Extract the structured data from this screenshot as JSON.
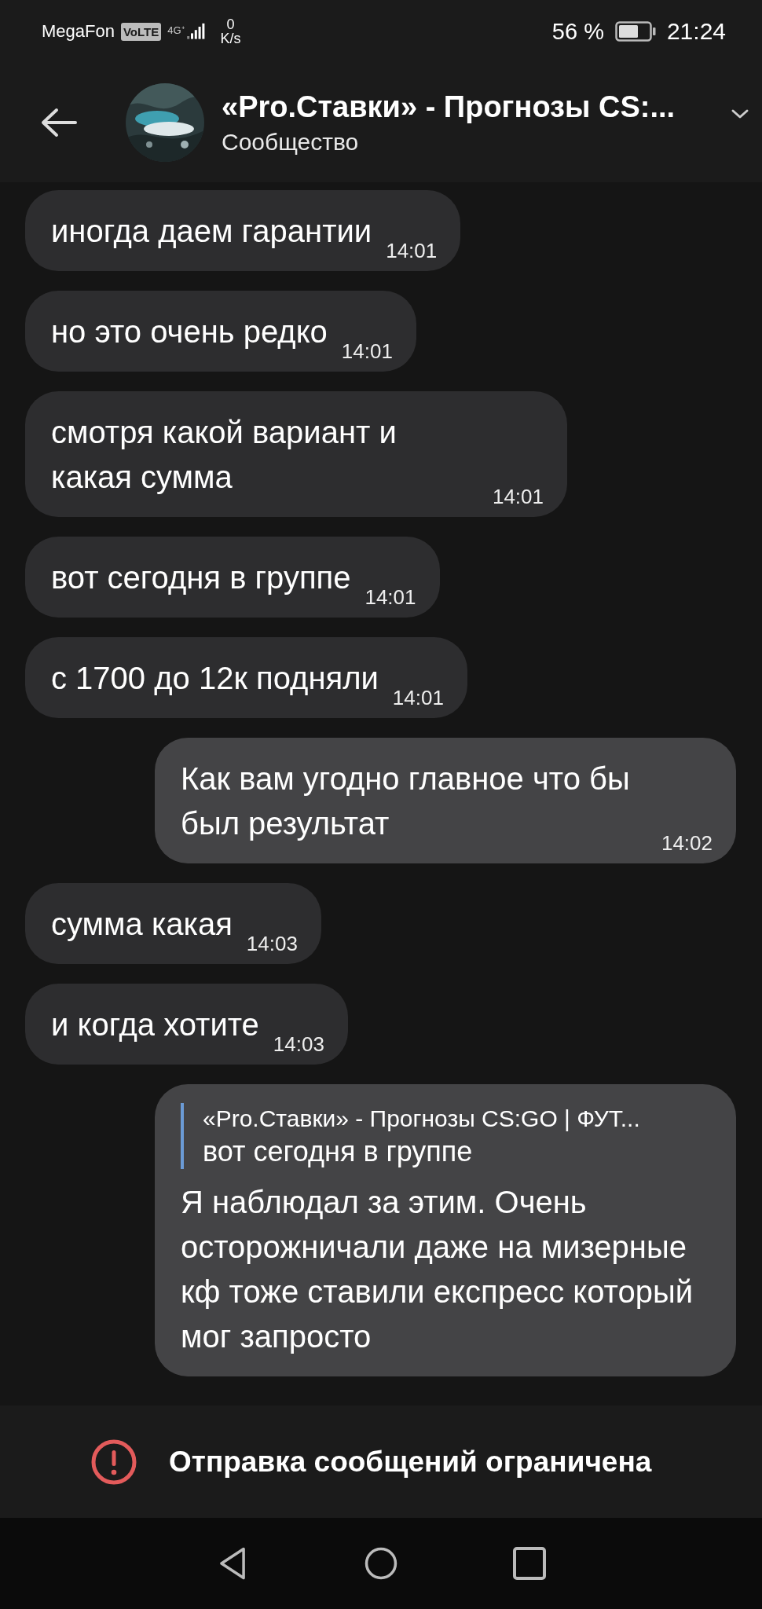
{
  "status_bar": {
    "carrier": "MegaFon",
    "volte": "VoLTE",
    "network": "4G⁺",
    "speed_value": "0",
    "speed_unit": "K/s",
    "battery": "56 %",
    "time": "21:24"
  },
  "header": {
    "title": "«Pro.Ставки» - Прогнозы CS:...",
    "subtitle": "Сообщество"
  },
  "messages": [
    {
      "kind": "incoming",
      "text": "иногда даем гарантии",
      "time": "14:01"
    },
    {
      "kind": "incoming",
      "text": "но это очень редко",
      "time": "14:01"
    },
    {
      "kind": "incoming",
      "text": "смотря какой вариант и какая сумма",
      "time": "14:01"
    },
    {
      "kind": "incoming",
      "text": "вот сегодня в группе",
      "time": "14:01"
    },
    {
      "kind": "incoming",
      "text": "с 1700 до 12к подняли",
      "time": "14:01"
    },
    {
      "kind": "outgoing",
      "text": "Как вам угодно главное что бы был результат",
      "time": "14:02"
    },
    {
      "kind": "incoming",
      "text": "сумма какая",
      "time": "14:03"
    },
    {
      "kind": "incoming",
      "text": "и когда хотите",
      "time": "14:03"
    },
    {
      "kind": "outgoing",
      "quote": {
        "author": "«Pro.Ставки» - Прогнозы CS:GO | ФУТ...",
        "text": "вот сегодня в группе"
      },
      "text": "Я наблюдал за этим. Очень осторожничали даже на мизерные кф тоже ставили експресс который мог запросто"
    }
  ],
  "footer": {
    "notice": "Отправка сообщений ограничена"
  }
}
